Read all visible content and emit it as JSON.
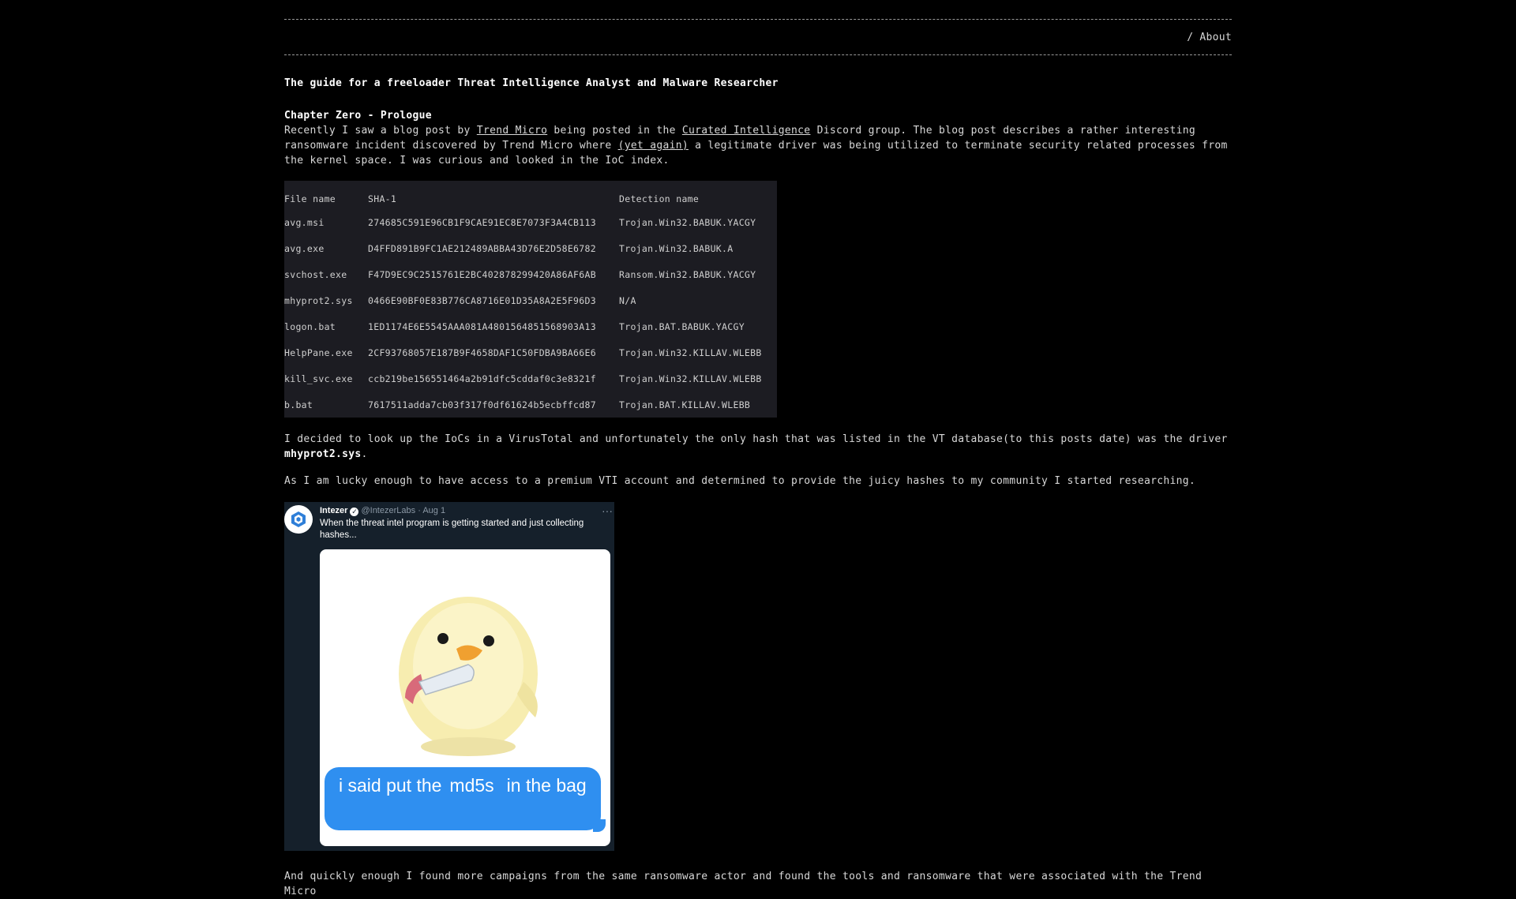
{
  "nav": {
    "separator": "/",
    "about_label": "About"
  },
  "post": {
    "title": "The guide for a freeloader Threat Intelligence Analyst and Malware Researcher",
    "chapter": "Chapter Zero - Prologue",
    "intro": {
      "t1": "Recently I saw a blog post by ",
      "link_trend": "Trend Micro",
      "t2": " being posted in the ",
      "link_curated": "Curated Intelligence",
      "t3": " Discord group. The blog post describes a rather interesting ransomware incident discovered by Trend Micro where ",
      "link_again": "(yet again)",
      "t4": " a legitimate driver was being utilized to terminate security related processes from the kernel space. I was curious and looked in the IoC index."
    },
    "ioc_table": {
      "headers": [
        "File name",
        "SHA-1",
        "Detection name"
      ],
      "rows": [
        [
          "avg.msi",
          "274685C591E96CB1F9CAE91EC8E7073F3A4CB113",
          "Trojan.Win32.BABUK.YACGY"
        ],
        [
          "avg.exe",
          "D4FFD891B9FC1AE212489ABBA43D76E2D58E6782",
          "Trojan.Win32.BABUK.A"
        ],
        [
          "svchost.exe",
          "F47D9EC9C2515761E2BC402878299420A86AF6AB",
          "Ransom.Win32.BABUK.YACGY"
        ],
        [
          "mhyprot2.sys",
          "0466E90BF0E83B776CA8716E01D35A8A2E5F96D3",
          "N/A"
        ],
        [
          "logon.bat",
          "1ED1174E6E5545AAA081A4801564851568903A13",
          "Trojan.BAT.BABUK.YACGY"
        ],
        [
          "HelpPane.exe",
          "2CF93768057E187B9F4658DAF1C50FDBA9BA66E6",
          "Trojan.Win32.KILLAV.WLEBB"
        ],
        [
          "kill_svc.exe",
          "ccb219be156551464a2b91dfc5cddaf0c3e8321f",
          "Trojan.Win32.KILLAV.WLEBB"
        ],
        [
          "b.bat",
          "7617511adda7cb03f317f0df61624b5ecbffcd87",
          "Trojan.BAT.KILLAV.WLEBB"
        ]
      ]
    },
    "para2": {
      "text": "I decided to look up the IoCs in a VirusTotal and unfortunately the only hash that was listed in the VT database(to this posts date) was the driver ",
      "bold": "mhyprot2.sys",
      "end": "."
    },
    "para3": "As I am lucky enough to have access to a premium VTI account and determined to provide the juicy hashes to my community I started researching.",
    "tweet": {
      "name": "Intezer",
      "handle": "@IntezerLabs",
      "dot": "·",
      "date": "Aug 1",
      "more": "···",
      "text": "When the threat intel program is getting started and just collecting hashes...",
      "meme_bubble": {
        "a": "i said put the",
        "b": "md5s",
        "c": "in the bag"
      }
    },
    "para4": "And quickly enough I found more campaigns from the same ransomware actor and found the tools and ransomware that were associated with the Trend Micro"
  },
  "colors": {
    "background": "#000000",
    "text": "#d8d8d8",
    "table_bg": "#1c1c22",
    "tweet_bg": "#15202b",
    "bubble": "#2f8ff0"
  }
}
